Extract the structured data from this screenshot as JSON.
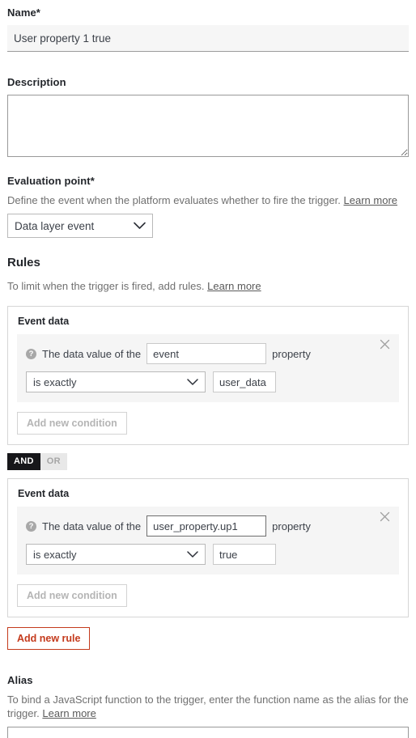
{
  "theme": {
    "accent": "#c43a1c",
    "text": "#2c3038",
    "muted": "#707070",
    "field_bg": "#f6f6f6",
    "condition_bg": "#f5f5f5",
    "toggle_on_bg": "#17171a"
  },
  "name_section": {
    "label": "Name*",
    "value": "User property 1 true",
    "placeholder": ""
  },
  "description_section": {
    "label": "Description",
    "value": "",
    "placeholder": ""
  },
  "evaluation_section": {
    "label": "Evaluation point*",
    "helper": "Define the event when the platform evaluates whether to fire the trigger.",
    "link": "Learn more",
    "selected": "Data layer event",
    "options": [
      "Data layer event"
    ]
  },
  "rules_section": {
    "title": "Rules",
    "helper": "To limit when the trigger is fired, add rules.",
    "link": "Learn more",
    "add_rule_label": "Add new rule",
    "connector": {
      "and_label": "AND",
      "or_label": "OR",
      "selected": "AND"
    },
    "cards": [
      {
        "title": "Event data",
        "add_condition_label": "Add new condition",
        "close_icon": "close-icon",
        "condition": {
          "help_icon": "help-circle-icon",
          "prefix_text": "The data value of the",
          "property_value": "event",
          "property_focused": false,
          "suffix_text": "property",
          "operator": "is exactly",
          "operator_options": [
            "is exactly"
          ],
          "value": "user_data"
        }
      },
      {
        "title": "Event data",
        "add_condition_label": "Add new condition",
        "close_icon": "close-icon",
        "condition": {
          "help_icon": "help-circle-icon",
          "prefix_text": "The data value of the",
          "property_value": "user_property.up1",
          "property_focused": true,
          "suffix_text": "property",
          "operator": "is exactly",
          "operator_options": [
            "is exactly"
          ],
          "value": "true"
        }
      }
    ]
  },
  "alias_section": {
    "label": "Alias",
    "helper": "To bind a JavaScript function to the trigger, enter the function name as the alias for the trigger.",
    "link": "Learn more"
  }
}
